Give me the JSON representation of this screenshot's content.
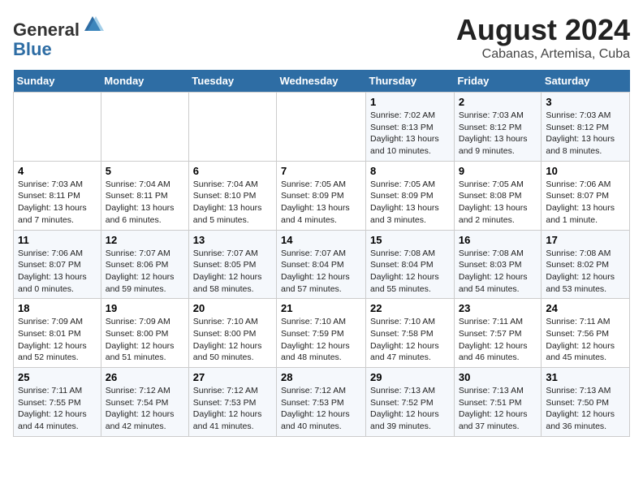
{
  "header": {
    "logo_general": "General",
    "logo_blue": "Blue",
    "title": "August 2024",
    "subtitle": "Cabanas, Artemisa, Cuba"
  },
  "days_of_week": [
    "Sunday",
    "Monday",
    "Tuesday",
    "Wednesday",
    "Thursday",
    "Friday",
    "Saturday"
  ],
  "weeks": [
    [
      {
        "day": "",
        "info": ""
      },
      {
        "day": "",
        "info": ""
      },
      {
        "day": "",
        "info": ""
      },
      {
        "day": "",
        "info": ""
      },
      {
        "day": "1",
        "info": "Sunrise: 7:02 AM\nSunset: 8:13 PM\nDaylight: 13 hours\nand 10 minutes."
      },
      {
        "day": "2",
        "info": "Sunrise: 7:03 AM\nSunset: 8:12 PM\nDaylight: 13 hours\nand 9 minutes."
      },
      {
        "day": "3",
        "info": "Sunrise: 7:03 AM\nSunset: 8:12 PM\nDaylight: 13 hours\nand 8 minutes."
      }
    ],
    [
      {
        "day": "4",
        "info": "Sunrise: 7:03 AM\nSunset: 8:11 PM\nDaylight: 13 hours\nand 7 minutes."
      },
      {
        "day": "5",
        "info": "Sunrise: 7:04 AM\nSunset: 8:11 PM\nDaylight: 13 hours\nand 6 minutes."
      },
      {
        "day": "6",
        "info": "Sunrise: 7:04 AM\nSunset: 8:10 PM\nDaylight: 13 hours\nand 5 minutes."
      },
      {
        "day": "7",
        "info": "Sunrise: 7:05 AM\nSunset: 8:09 PM\nDaylight: 13 hours\nand 4 minutes."
      },
      {
        "day": "8",
        "info": "Sunrise: 7:05 AM\nSunset: 8:09 PM\nDaylight: 13 hours\nand 3 minutes."
      },
      {
        "day": "9",
        "info": "Sunrise: 7:05 AM\nSunset: 8:08 PM\nDaylight: 13 hours\nand 2 minutes."
      },
      {
        "day": "10",
        "info": "Sunrise: 7:06 AM\nSunset: 8:07 PM\nDaylight: 13 hours\nand 1 minute."
      }
    ],
    [
      {
        "day": "11",
        "info": "Sunrise: 7:06 AM\nSunset: 8:07 PM\nDaylight: 13 hours\nand 0 minutes."
      },
      {
        "day": "12",
        "info": "Sunrise: 7:07 AM\nSunset: 8:06 PM\nDaylight: 12 hours\nand 59 minutes."
      },
      {
        "day": "13",
        "info": "Sunrise: 7:07 AM\nSunset: 8:05 PM\nDaylight: 12 hours\nand 58 minutes."
      },
      {
        "day": "14",
        "info": "Sunrise: 7:07 AM\nSunset: 8:04 PM\nDaylight: 12 hours\nand 57 minutes."
      },
      {
        "day": "15",
        "info": "Sunrise: 7:08 AM\nSunset: 8:04 PM\nDaylight: 12 hours\nand 55 minutes."
      },
      {
        "day": "16",
        "info": "Sunrise: 7:08 AM\nSunset: 8:03 PM\nDaylight: 12 hours\nand 54 minutes."
      },
      {
        "day": "17",
        "info": "Sunrise: 7:08 AM\nSunset: 8:02 PM\nDaylight: 12 hours\nand 53 minutes."
      }
    ],
    [
      {
        "day": "18",
        "info": "Sunrise: 7:09 AM\nSunset: 8:01 PM\nDaylight: 12 hours\nand 52 minutes."
      },
      {
        "day": "19",
        "info": "Sunrise: 7:09 AM\nSunset: 8:00 PM\nDaylight: 12 hours\nand 51 minutes."
      },
      {
        "day": "20",
        "info": "Sunrise: 7:10 AM\nSunset: 8:00 PM\nDaylight: 12 hours\nand 50 minutes."
      },
      {
        "day": "21",
        "info": "Sunrise: 7:10 AM\nSunset: 7:59 PM\nDaylight: 12 hours\nand 48 minutes."
      },
      {
        "day": "22",
        "info": "Sunrise: 7:10 AM\nSunset: 7:58 PM\nDaylight: 12 hours\nand 47 minutes."
      },
      {
        "day": "23",
        "info": "Sunrise: 7:11 AM\nSunset: 7:57 PM\nDaylight: 12 hours\nand 46 minutes."
      },
      {
        "day": "24",
        "info": "Sunrise: 7:11 AM\nSunset: 7:56 PM\nDaylight: 12 hours\nand 45 minutes."
      }
    ],
    [
      {
        "day": "25",
        "info": "Sunrise: 7:11 AM\nSunset: 7:55 PM\nDaylight: 12 hours\nand 44 minutes."
      },
      {
        "day": "26",
        "info": "Sunrise: 7:12 AM\nSunset: 7:54 PM\nDaylight: 12 hours\nand 42 minutes."
      },
      {
        "day": "27",
        "info": "Sunrise: 7:12 AM\nSunset: 7:53 PM\nDaylight: 12 hours\nand 41 minutes."
      },
      {
        "day": "28",
        "info": "Sunrise: 7:12 AM\nSunset: 7:53 PM\nDaylight: 12 hours\nand 40 minutes."
      },
      {
        "day": "29",
        "info": "Sunrise: 7:13 AM\nSunset: 7:52 PM\nDaylight: 12 hours\nand 39 minutes."
      },
      {
        "day": "30",
        "info": "Sunrise: 7:13 AM\nSunset: 7:51 PM\nDaylight: 12 hours\nand 37 minutes."
      },
      {
        "day": "31",
        "info": "Sunrise: 7:13 AM\nSunset: 7:50 PM\nDaylight: 12 hours\nand 36 minutes."
      }
    ]
  ]
}
